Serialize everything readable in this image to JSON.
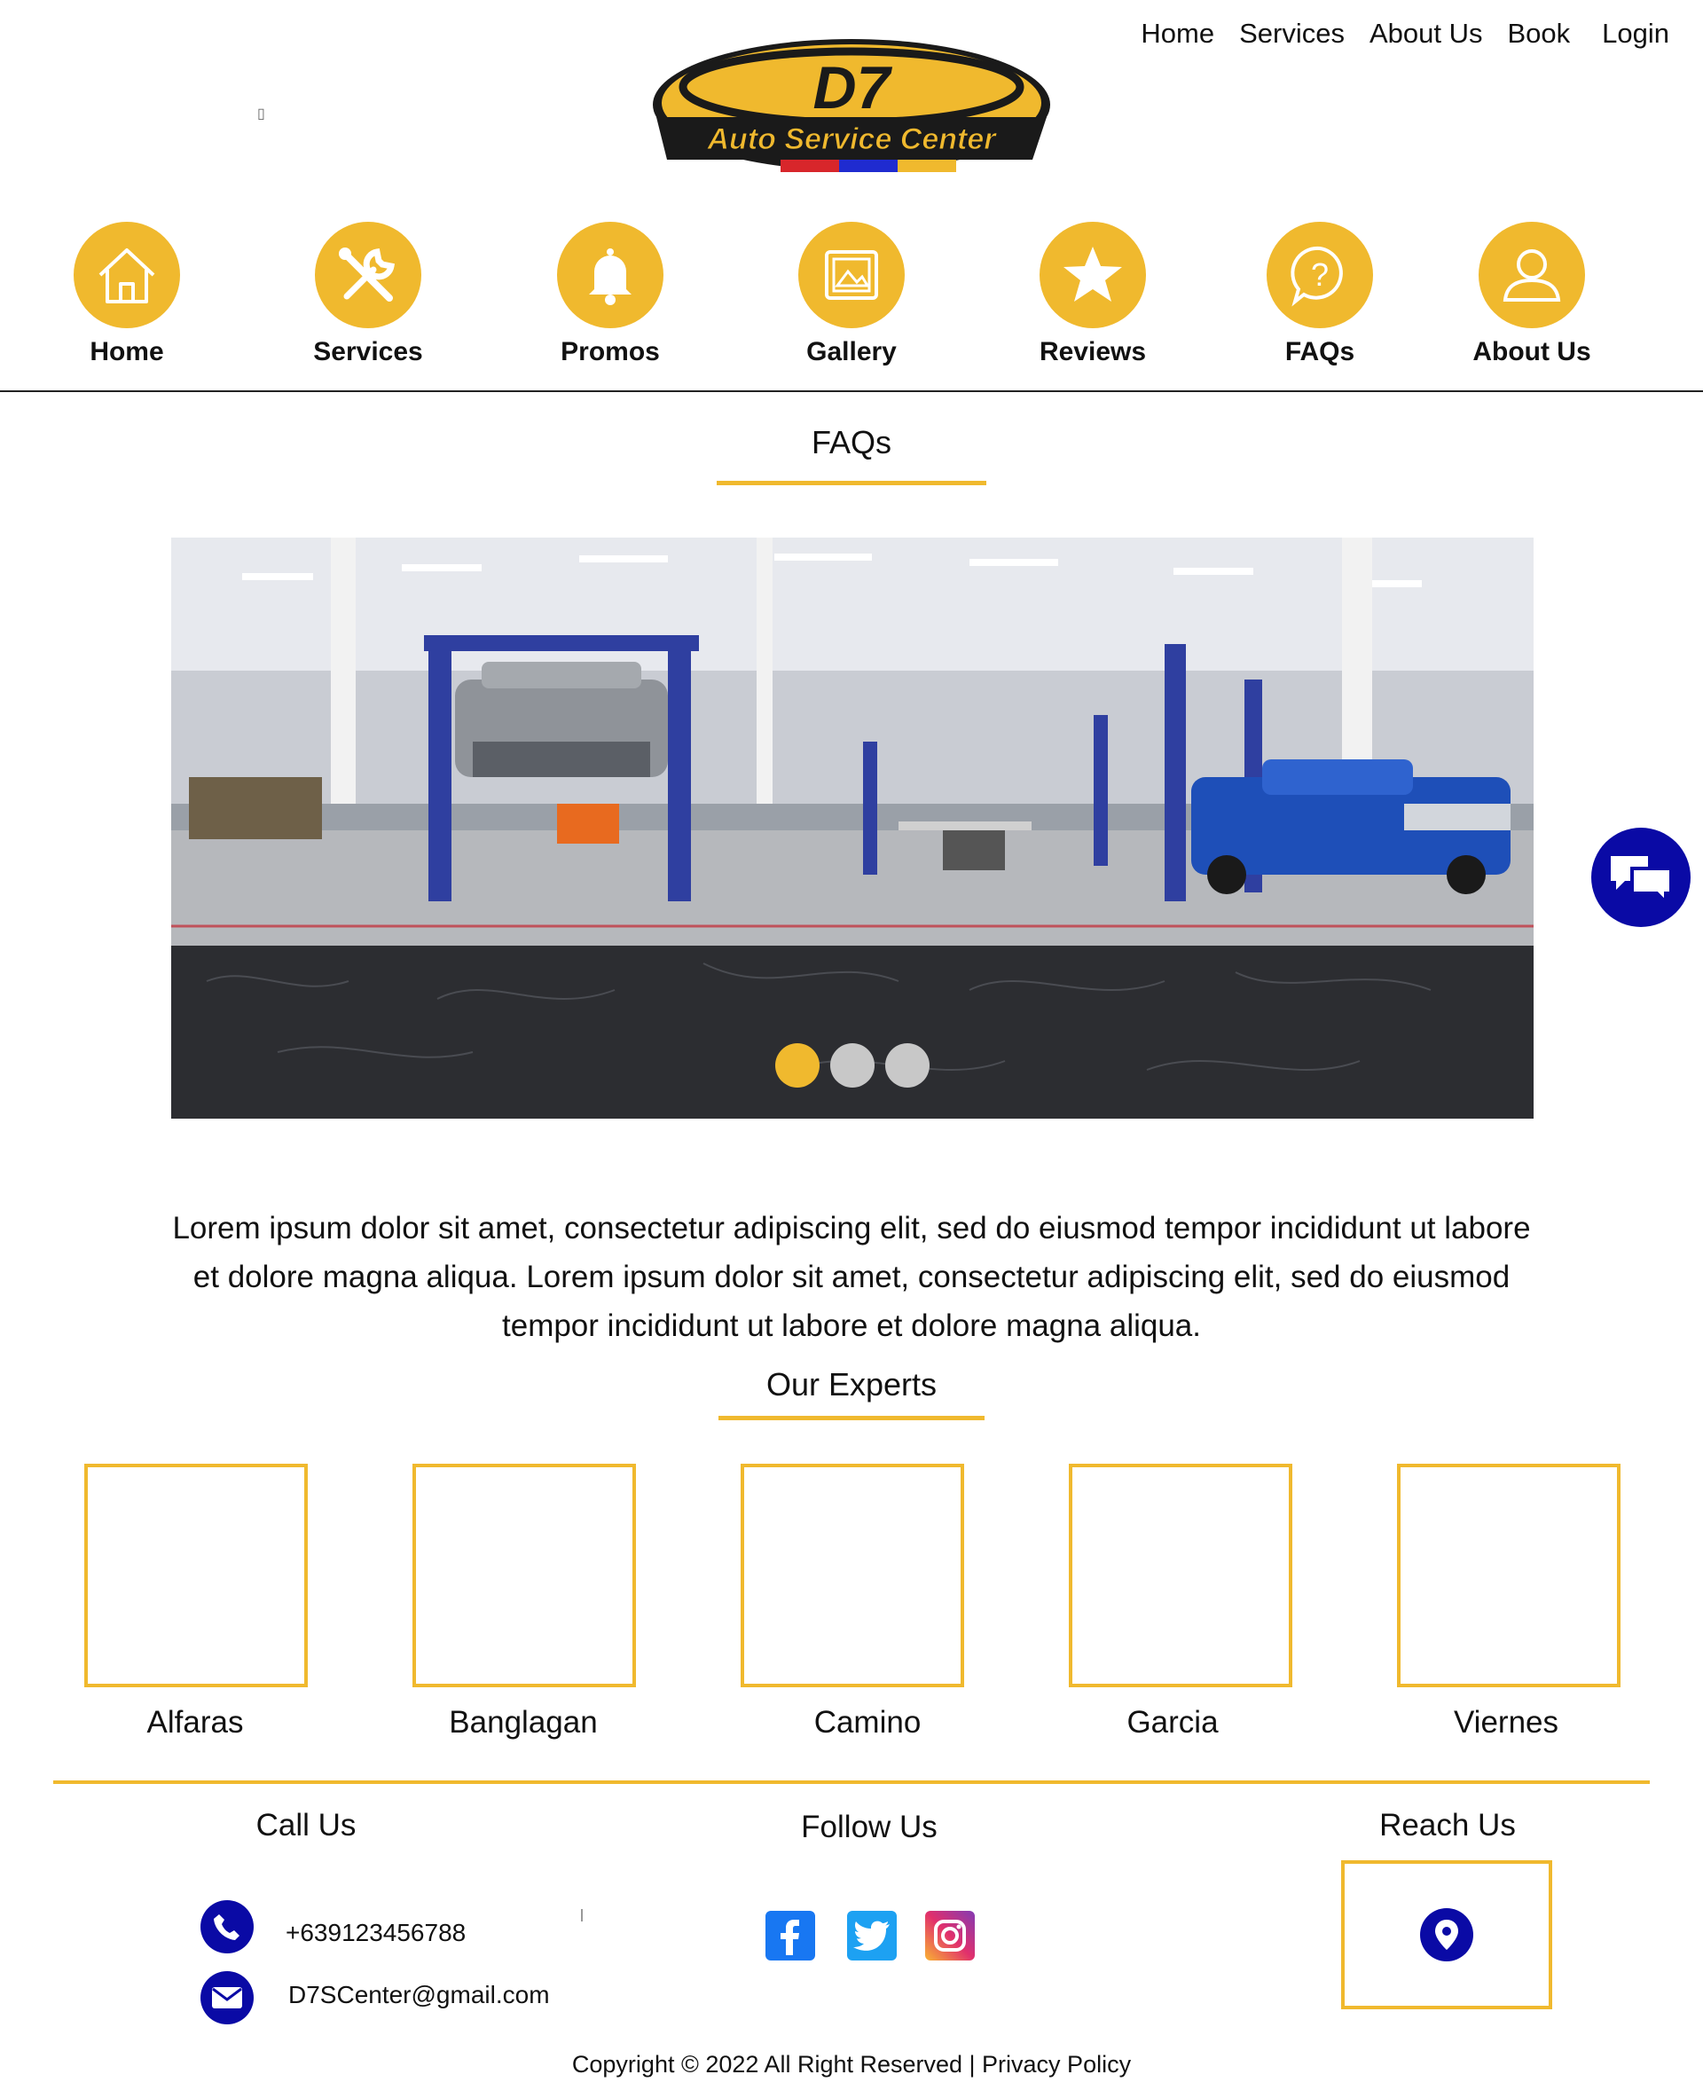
{
  "top_nav": {
    "items": [
      "Home",
      "Services",
      "About Us",
      "Book",
      "Login"
    ]
  },
  "logo": {
    "brand": "D7",
    "tagline": "Auto Service Center"
  },
  "icon_nav": {
    "items": [
      {
        "label": "Home",
        "icon": "home-icon"
      },
      {
        "label": "Services",
        "icon": "tools-icon"
      },
      {
        "label": "Promos",
        "icon": "bell-icon"
      },
      {
        "label": "Gallery",
        "icon": "image-icon"
      },
      {
        "label": "Reviews",
        "icon": "star-icon"
      },
      {
        "label": "FAQs",
        "icon": "question-icon"
      },
      {
        "label": "About Us",
        "icon": "user-icon"
      }
    ]
  },
  "page": {
    "title": "FAQs",
    "body": "Lorem ipsum dolor sit amet, consectetur adipiscing elit, sed do  eiusmod tempor incididunt ut labore et dolore magna aliqua. Lorem ipsum dolor sit amet, consectetur adipiscing elit, sed do eiusmod tempor incididunt ut labore et dolore magna aliqua."
  },
  "carousel": {
    "slides": 3,
    "active_index": 0
  },
  "experts": {
    "title": "Our Experts",
    "names": [
      "Alfaras",
      "Banglagan",
      "Camino",
      "Garcia",
      "Viernes"
    ]
  },
  "footer": {
    "call_title": "Call Us",
    "phone": "+639123456788",
    "email": "D7SCenter@gmail.com",
    "follow_title": "Follow Us",
    "socials": [
      "facebook-icon",
      "twitter-icon",
      "instagram-icon"
    ],
    "reach_title": "Reach Us",
    "copyright": "Copyright © 2022 All Right Reserved | Privacy Policy"
  },
  "colors": {
    "accent": "#f0b92e",
    "brand_blue": "#0a0aa5",
    "text": "#111111"
  }
}
